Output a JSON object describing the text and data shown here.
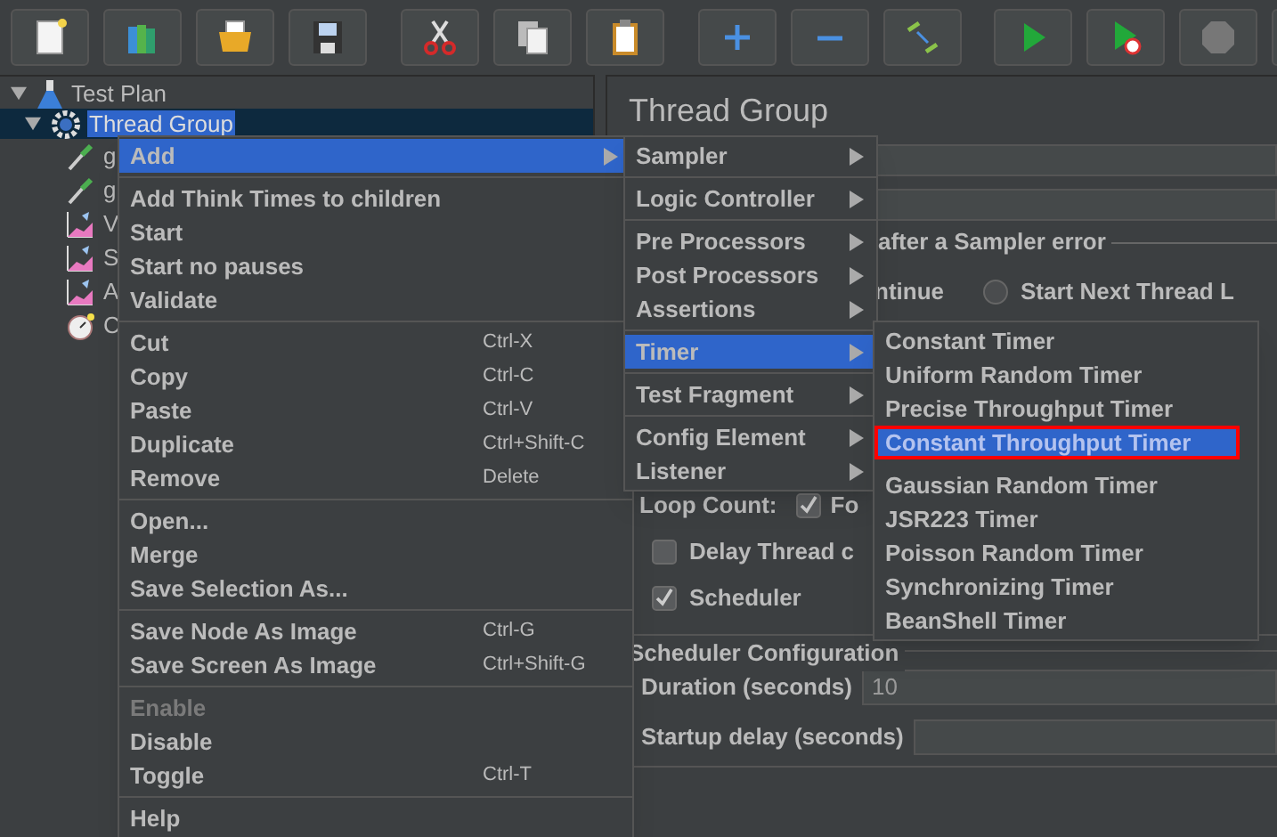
{
  "tree": {
    "items": [
      {
        "label": "Test Plan",
        "kind": "plan",
        "expanded": true,
        "selected": false,
        "children": [
          {
            "label": "Thread Group",
            "kind": "thread_group",
            "expanded": true,
            "selected": true,
            "children": [
              {
                "label": "g",
                "kind": "sampler",
                "selected": false
              },
              {
                "label": "g",
                "kind": "sampler",
                "selected": false
              },
              {
                "label": "V",
                "kind": "listener",
                "selected": false
              },
              {
                "label": "S",
                "kind": "listener",
                "selected": false
              },
              {
                "label": "A",
                "kind": "listener",
                "selected": false
              },
              {
                "label": "C",
                "kind": "timer",
                "selected": false
              }
            ]
          }
        ]
      }
    ]
  },
  "panel": {
    "title": "Thread Group",
    "error_action": {
      "legend": "after a Sampler error",
      "option_continue": "ntinue",
      "option_next_loop": {
        "label": "Start Next Thread L",
        "selected": false
      }
    },
    "loop_count": {
      "label": "Loop Count:",
      "checked": true,
      "option": "Fo"
    },
    "options": [
      {
        "label": "Delay Thread c",
        "checked": false
      },
      {
        "label": "Scheduler",
        "checked": true
      }
    ],
    "scheduler": {
      "legend": "Scheduler Configuration",
      "fields": [
        {
          "label": "Duration (seconds)",
          "value": "10"
        },
        {
          "label": "Startup delay (seconds)"
        }
      ]
    }
  },
  "context_menu": {
    "groups": [
      {
        "items": [
          {
            "label": "Add",
            "selected": true,
            "disabled": false,
            "submenu": true
          }
        ]
      },
      {
        "items": [
          {
            "label": "Add Think Times to children",
            "selected": false,
            "disabled": false,
            "submenu": false
          },
          {
            "label": "Start",
            "selected": false,
            "disabled": false,
            "submenu": false
          },
          {
            "label": "Start no pauses",
            "selected": false,
            "disabled": false,
            "submenu": false
          },
          {
            "label": "Validate",
            "selected": false,
            "disabled": false,
            "submenu": false
          }
        ]
      },
      {
        "items": [
          {
            "label": "Cut",
            "shortcut": "Ctrl-X",
            "selected": false,
            "disabled": false,
            "submenu": false
          },
          {
            "label": "Copy",
            "shortcut": "Ctrl-C",
            "selected": false,
            "disabled": false,
            "submenu": false
          },
          {
            "label": "Paste",
            "shortcut": "Ctrl-V",
            "selected": false,
            "disabled": false,
            "submenu": false
          },
          {
            "label": "Duplicate",
            "shortcut": "Ctrl+Shift-C",
            "selected": false,
            "disabled": false,
            "submenu": false
          },
          {
            "label": "Remove",
            "shortcut": "Delete",
            "selected": false,
            "disabled": false,
            "submenu": false
          }
        ]
      },
      {
        "items": [
          {
            "label": "Open...",
            "selected": false,
            "disabled": false,
            "submenu": false
          },
          {
            "label": "Merge",
            "selected": false,
            "disabled": false,
            "submenu": false
          },
          {
            "label": "Save Selection As...",
            "selected": false,
            "disabled": false,
            "submenu": false
          }
        ]
      },
      {
        "items": [
          {
            "label": "Save Node As Image",
            "shortcut": "Ctrl-G",
            "selected": false,
            "disabled": false,
            "submenu": false
          },
          {
            "label": "Save Screen As Image",
            "shortcut": "Ctrl+Shift-G",
            "selected": false,
            "disabled": false,
            "submenu": false
          }
        ]
      },
      {
        "items": [
          {
            "label": "Enable",
            "selected": false,
            "disabled": true,
            "submenu": false
          },
          {
            "label": "Disable",
            "selected": false,
            "disabled": false,
            "submenu": false
          },
          {
            "label": "Toggle",
            "shortcut": "Ctrl-T",
            "selected": false,
            "disabled": false,
            "submenu": false
          }
        ]
      },
      {
        "items": [
          {
            "label": "Help",
            "selected": false,
            "disabled": false,
            "submenu": false
          }
        ]
      }
    ]
  },
  "add_menu": {
    "groups": [
      {
        "items": [
          {
            "label": "Sampler",
            "selected": false,
            "submenu": true
          }
        ]
      },
      {
        "items": [
          {
            "label": "Logic Controller",
            "selected": false,
            "submenu": true
          }
        ]
      },
      {
        "items": [
          {
            "label": "Pre Processors",
            "selected": false,
            "submenu": true
          },
          {
            "label": "Post Processors",
            "selected": false,
            "submenu": true
          },
          {
            "label": "Assertions",
            "selected": false,
            "submenu": true
          }
        ]
      },
      {
        "items": [
          {
            "label": "Timer",
            "selected": true,
            "submenu": true
          }
        ]
      },
      {
        "items": [
          {
            "label": "Test Fragment",
            "selected": false,
            "submenu": true
          }
        ]
      },
      {
        "items": [
          {
            "label": "Config Element",
            "selected": false,
            "submenu": true
          },
          {
            "label": "Listener",
            "selected": false,
            "submenu": true
          }
        ]
      }
    ]
  },
  "timer_menu": {
    "items": [
      {
        "label": "Constant Timer",
        "selected": false,
        "outlined": false
      },
      {
        "label": "Uniform Random Timer",
        "selected": false,
        "outlined": false
      },
      {
        "label": "Precise Throughput Timer",
        "selected": false,
        "outlined": false
      },
      {
        "label": "Constant Throughput Timer",
        "selected": true,
        "outlined": true
      },
      {
        "label": "Gaussian Random Timer",
        "selected": false,
        "outlined": false
      },
      {
        "label": "JSR223 Timer",
        "selected": false,
        "outlined": false
      },
      {
        "label": "Poisson Random Timer",
        "selected": false,
        "outlined": false
      },
      {
        "label": "Synchronizing Timer",
        "selected": false,
        "outlined": false
      },
      {
        "label": "BeanShell Timer",
        "selected": false,
        "outlined": false
      }
    ]
  }
}
